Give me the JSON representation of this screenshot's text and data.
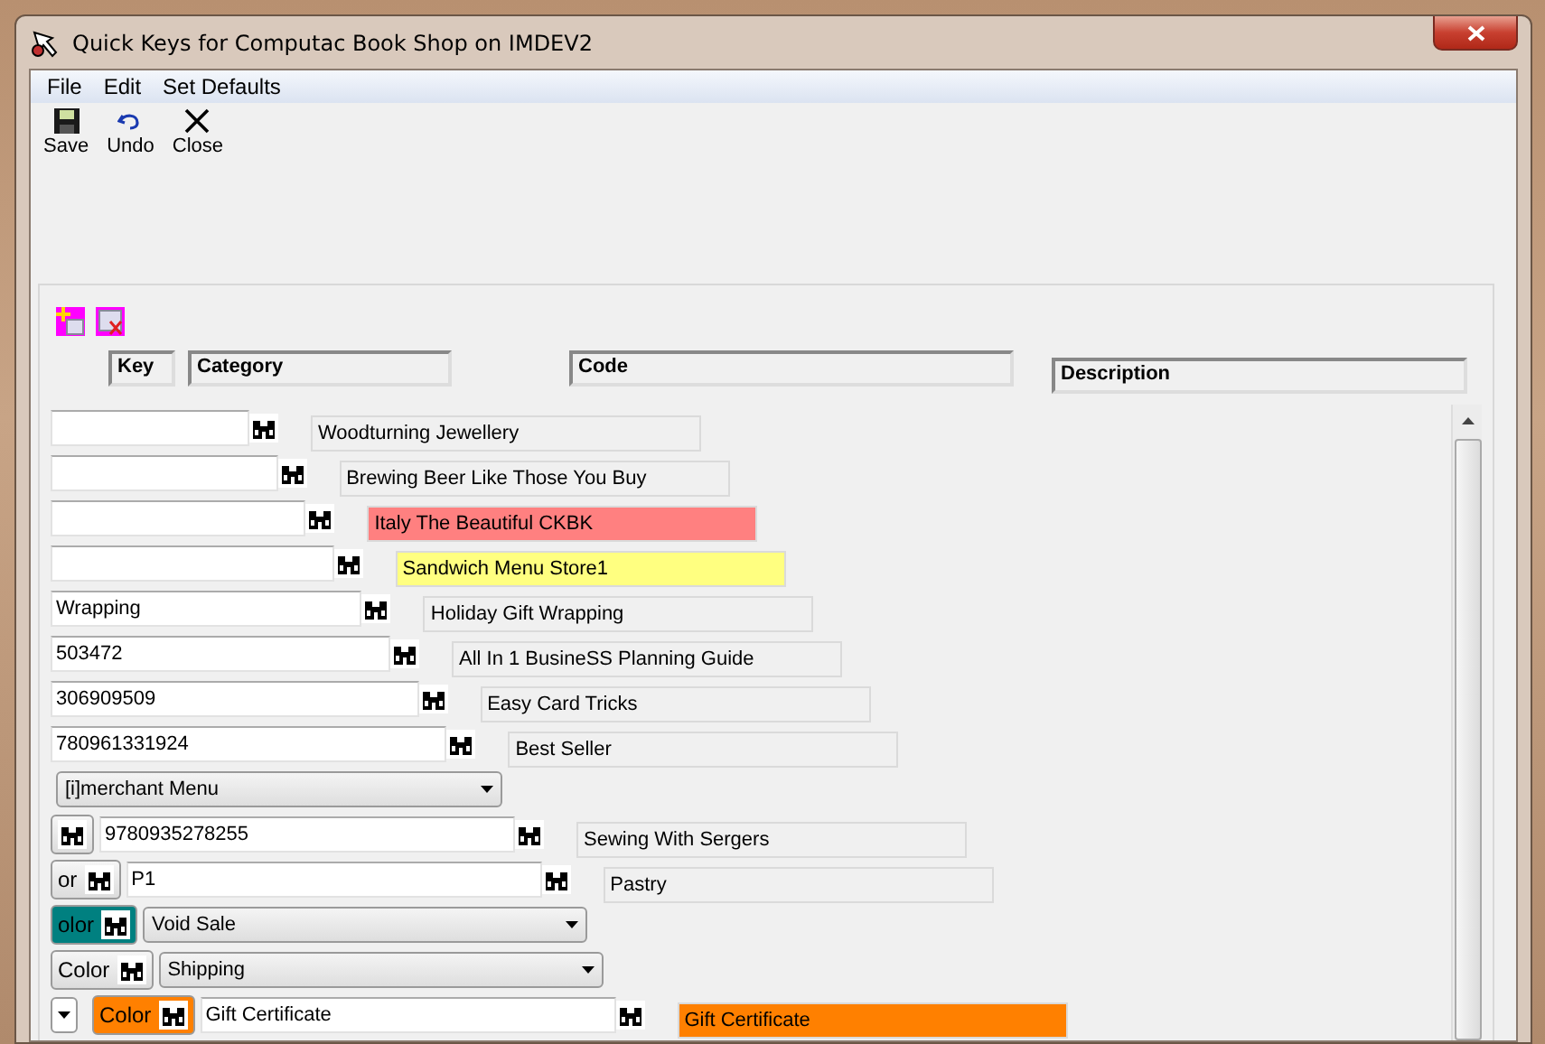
{
  "window": {
    "title": "Quick Keys for Computac Book Shop on IMDEV2"
  },
  "menu": [
    "File",
    "Edit",
    "Set Defaults"
  ],
  "toolbar": [
    {
      "kind": "save",
      "label": "Save"
    },
    {
      "kind": "undo",
      "label": "Undo"
    },
    {
      "kind": "close",
      "label": "Close"
    }
  ],
  "grid": {
    "columns": [
      "Key",
      "Category",
      "Code",
      "Description"
    ],
    "rows": [
      {
        "kind": "lookup",
        "description": "Woodturning Jewellery"
      },
      {
        "kind": "lookup",
        "description": "Brewing Beer Like Those You Buy"
      },
      {
        "kind": "lookup",
        "description": "Italy The Beautiful CKBK",
        "color": "#ff8080"
      },
      {
        "kind": "lookup",
        "description": "Sandwich Menu Store1",
        "color": "#ffff80"
      },
      {
        "kind": "lookup",
        "value": "Wrapping",
        "description": "Holiday Gift Wrapping"
      },
      {
        "kind": "lookup",
        "value": "503472",
        "description": "All In 1 BusineSS Planning Guide"
      },
      {
        "kind": "lookup",
        "value": "306909509",
        "description": "Easy Card Tricks"
      },
      {
        "kind": "lookup",
        "value": "780961331924",
        "description": "Best Seller"
      },
      {
        "kind": "menu",
        "value": "[i]merchant Menu"
      },
      {
        "kind": "color-lookup",
        "value": "9780935278255",
        "description": "Sewing With Sergers"
      },
      {
        "kind": "color-lookup",
        "button": {
          "label": "or"
        },
        "value": "P1",
        "description": "Pastry"
      },
      {
        "kind": "color-select",
        "button": {
          "label": "olor",
          "color": "#008080"
        },
        "value": "Void Sale"
      },
      {
        "kind": "color-select",
        "button": {
          "label": "Color"
        },
        "value": "Shipping"
      },
      {
        "kind": "color-lookup",
        "lead_select": true,
        "button": {
          "label": "Color",
          "color": "#ff8000"
        },
        "value": "Gift Certificate",
        "description": "Gift Certificate",
        "color": "#ff8000"
      }
    ]
  }
}
